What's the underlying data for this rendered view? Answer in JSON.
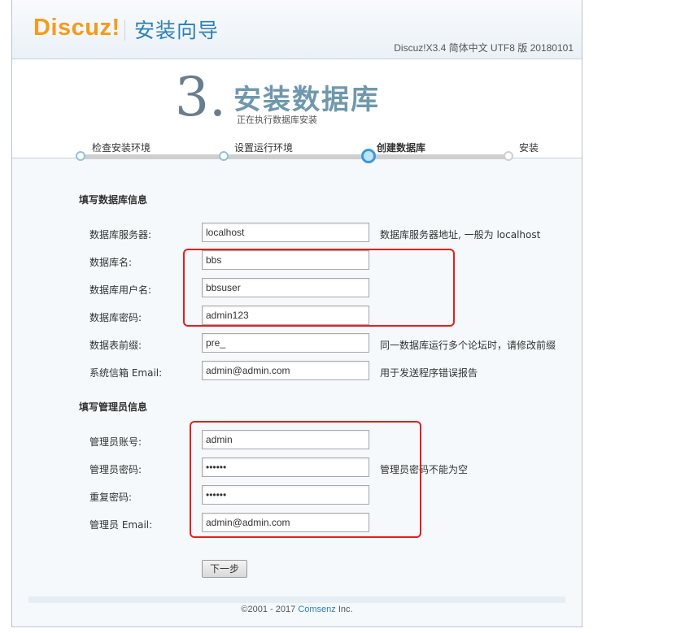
{
  "header": {
    "logo_text": "Discuz!",
    "title": "安装向导",
    "version": "Discuz!X3.4 简体中文 UTF8 版 20180101"
  },
  "step": {
    "number": "3.",
    "title": "安装数据库",
    "subtitle": "正在执行数据库安装",
    "steps": [
      {
        "label": "检查安装环境",
        "state": "done"
      },
      {
        "label": "设置运行环境",
        "state": "done"
      },
      {
        "label": "创建数据库",
        "state": "current"
      },
      {
        "label": "安装",
        "state": "todo"
      }
    ]
  },
  "db_section": {
    "title": "填写数据库信息",
    "fields": [
      {
        "label": "数据库服务器:",
        "value": "localhost",
        "hint": "数据库服务器地址, 一般为 localhost"
      },
      {
        "label": "数据库名:",
        "value": "bbs",
        "hint": ""
      },
      {
        "label": "数据库用户名:",
        "value": "bbsuser",
        "hint": ""
      },
      {
        "label": "数据库密码:",
        "value": "admin123",
        "hint": ""
      },
      {
        "label": "数据表前缀:",
        "value": "pre_",
        "hint": "同一数据库运行多个论坛时，请修改前缀"
      },
      {
        "label": "系统信箱 Email:",
        "value": "admin@admin.com",
        "hint": "用于发送程序错误报告"
      }
    ]
  },
  "admin_section": {
    "title": "填写管理员信息",
    "fields": [
      {
        "label": "管理员账号:",
        "value": "admin",
        "hint": ""
      },
      {
        "label": "管理员密码:",
        "value": "••••••",
        "hint": "管理员密码不能为空"
      },
      {
        "label": "重复密码:",
        "value": "••••••",
        "hint": ""
      },
      {
        "label": "管理员 Email:",
        "value": "admin@admin.com",
        "hint": ""
      }
    ]
  },
  "buttons": {
    "next": "下一步"
  },
  "footer": {
    "prefix": "©2001 - 2017 ",
    "company": "Comsenz",
    "suffix": " Inc."
  },
  "colors": {
    "brand_orange": "#f49b1e",
    "brand_blue": "#2f7fb5",
    "annotation_red": "#e02020"
  }
}
